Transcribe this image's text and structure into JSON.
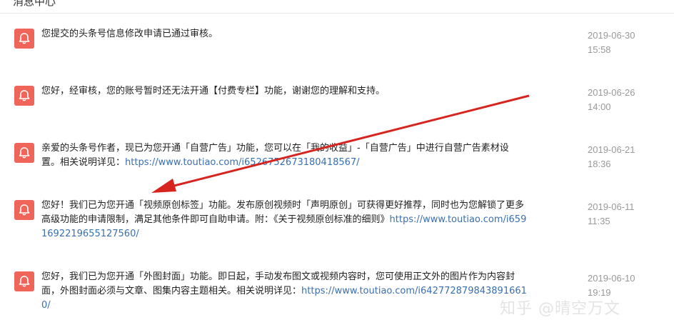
{
  "header": {
    "title": "消息中心"
  },
  "notices": [
    {
      "text": "您提交的头条号信息修改申请已通过审核。",
      "link": "",
      "date": "2019-06-30",
      "time": "15:58"
    },
    {
      "text": "您好，经审核，您的账号暂时还无法开通【付费专栏】功能，谢谢您的理解和支持。",
      "link": "",
      "date": "2019-06-26",
      "time": "14:00"
    },
    {
      "text": "亲爱的头条号作者，现已为您开通「自营广告」功能，您可以在「我的收益」-「自营广告」中进行自营广告素材设置。相关说明详见：",
      "link": "https://www.toutiao.com/i6526752673180418567/",
      "date": "2019-06-21",
      "time": "18:36"
    },
    {
      "text": "您好！我们已为您开通「视频原创标签」功能。发布原创视频时「声明原创」可获得更好推荐，同时也为您解锁了更多高级功能的申请限制，满足其他条件即可自助申请。附：《关于视频原创标准的细则》",
      "link": "https://www.toutiao.com/i6591692219655127560/",
      "date": "2019-06-11",
      "time": "11:35"
    },
    {
      "text": "您好，我们已为您开通「外图封面」功能。即日起，手动发布图文或视频内容时，您可使用正文外的图片作为内容封面，外图封面必须与文章、图集内容主题相关。相关说明详见：",
      "link": "https://www.toutiao.com/i6427728798438916610/",
      "date": "2019-06-10",
      "time": "19:19"
    }
  ],
  "icons": {
    "notice": "bell-icon"
  },
  "colors": {
    "bell_bg": "#f0655a",
    "link": "#3a6fb0",
    "date": "#999999",
    "arrow": "#d8241f"
  },
  "watermark": "知乎 @晴空万文"
}
